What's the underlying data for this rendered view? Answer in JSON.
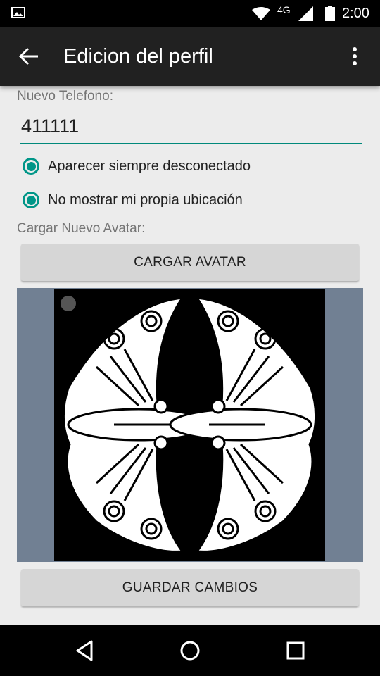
{
  "status_bar": {
    "network": "4G",
    "time": "2:00",
    "icons": [
      "image-notification-icon",
      "wifi-icon",
      "signal-icon",
      "battery-icon"
    ]
  },
  "app_bar": {
    "title": "Edicion del perfil",
    "icons": [
      "back-arrow-icon",
      "overflow-menu-icon"
    ]
  },
  "form": {
    "phone_label": "Nuevo Telefono:",
    "phone_value": "411111",
    "options": [
      {
        "label": "Aparecer siempre desconectado",
        "checked": true
      },
      {
        "label": "No mostrar mi propia ubicación",
        "checked": true
      }
    ],
    "avatar_label": "Cargar Nuevo Avatar:",
    "upload_button": "CARGAR AVATAR",
    "save_button": "GUARDAR CAMBIOS"
  },
  "colors": {
    "accent": "#009688",
    "app_bar": "#212121",
    "avatar_frame": "#718093"
  },
  "nav_bar": {
    "icons": [
      "nav-back-icon",
      "nav-home-icon",
      "nav-recents-icon"
    ]
  }
}
